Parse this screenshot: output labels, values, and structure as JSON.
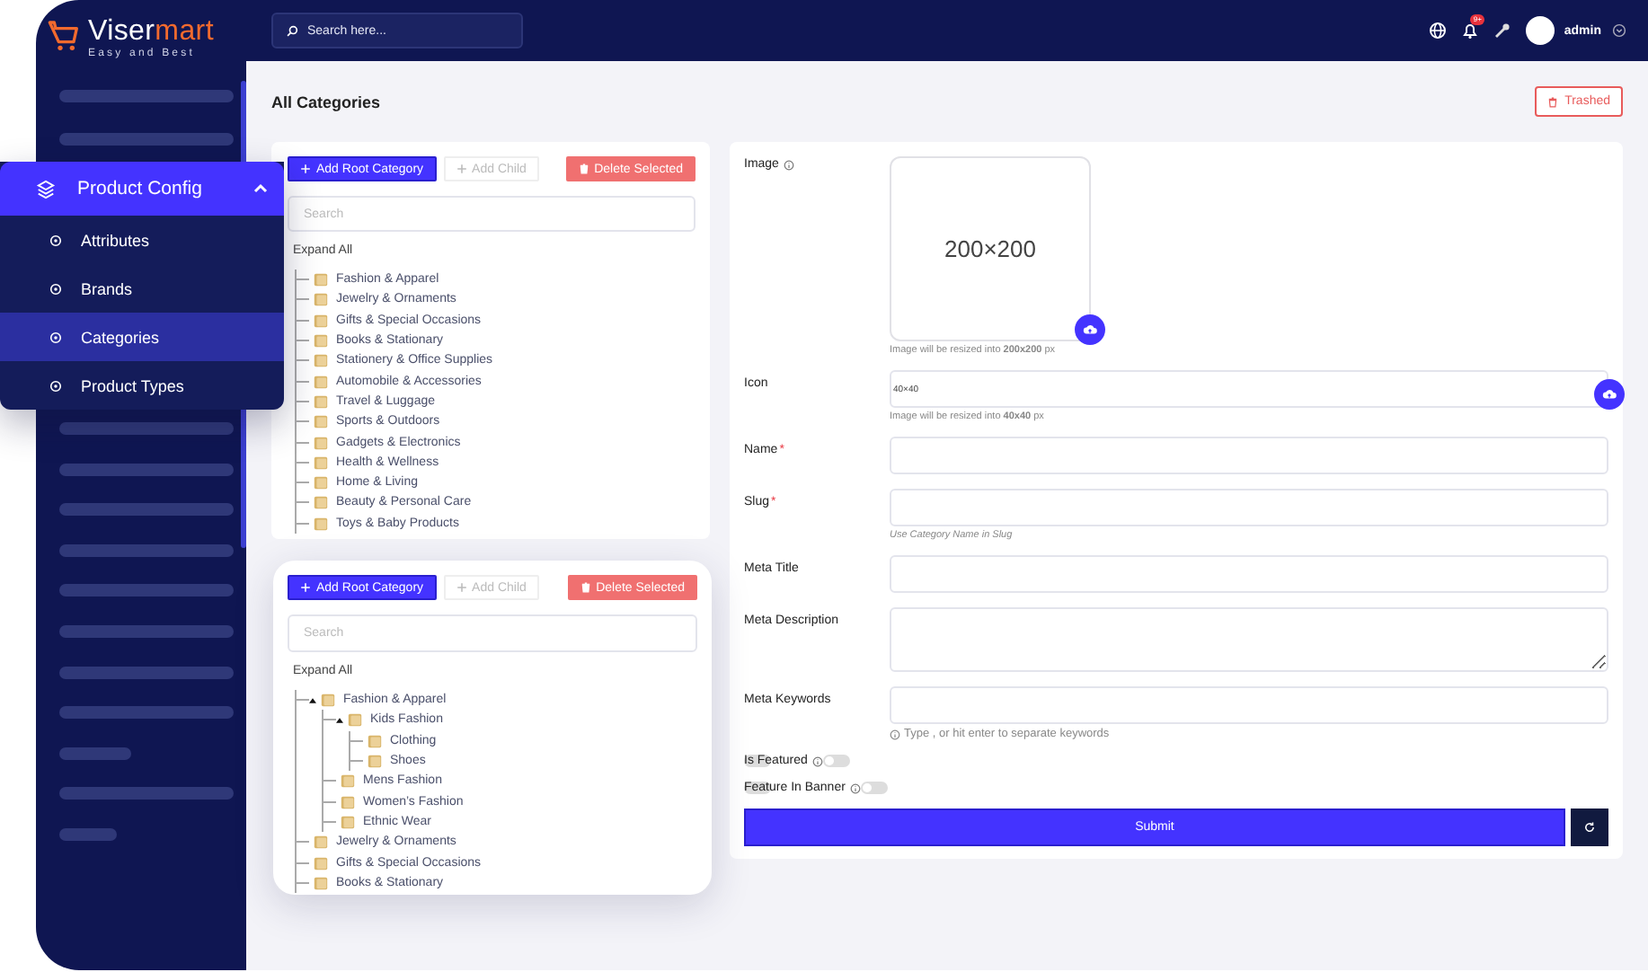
{
  "brand": {
    "name_start": "Viser",
    "name_end": "mart",
    "tagline": "Easy and Best"
  },
  "header": {
    "search_placeholder": "Search here...",
    "notification_count": "9+",
    "user_name": "admin"
  },
  "sidebar_menu": {
    "title": "Product Config",
    "expanded": true,
    "items": [
      {
        "label": "Attributes",
        "selected": false
      },
      {
        "label": "Brands",
        "selected": false
      },
      {
        "label": "Categories",
        "selected": true
      },
      {
        "label": "Product Types",
        "selected": false
      }
    ]
  },
  "page_title": "All Categories",
  "trashed_button": "Trashed",
  "category_trees": [
    {
      "buttons": [
        {
          "kind": "add-root",
          "label": "Add Root Category",
          "disabled": false
        },
        {
          "kind": "add-child",
          "label": "Add Child",
          "disabled": true
        },
        {
          "kind": "delete",
          "label": "Delete Selected",
          "disabled": false
        }
      ],
      "search_placeholder": "Search",
      "expand_all": "Expand All",
      "nodes": [
        {
          "label": "Fashion & Apparel"
        },
        {
          "label": "Jewelry & Ornaments"
        },
        {
          "label": "Gifts & Special Occasions"
        },
        {
          "label": "Books & Stationary"
        },
        {
          "label": "Stationery & Office Supplies"
        },
        {
          "label": "Automobile & Accessories"
        },
        {
          "label": "Travel & Luggage"
        },
        {
          "label": "Sports & Outdoors"
        },
        {
          "label": "Gadgets & Electronics"
        },
        {
          "label": "Health & Wellness"
        },
        {
          "label": "Home & Living"
        },
        {
          "label": "Beauty & Personal Care"
        },
        {
          "label": "Toys & Baby Products"
        }
      ]
    },
    {
      "buttons": [
        {
          "kind": "add-root",
          "label": "Add Root Category",
          "disabled": false
        },
        {
          "kind": "add-child",
          "label": "Add Child",
          "disabled": true
        },
        {
          "kind": "delete",
          "label": "Delete Selected",
          "disabled": false
        }
      ],
      "search_placeholder": "Search",
      "expand_all": "Expand All",
      "nodes": [
        {
          "label": "Fashion & Apparel",
          "children": [
            {
              "label": "Kids Fashion",
              "children": [
                {
                  "label": "Clothing"
                },
                {
                  "label": "Shoes"
                }
              ]
            },
            {
              "label": "Mens Fashion"
            },
            {
              "label": "Women’s Fashion"
            },
            {
              "label": "Ethnic Wear"
            }
          ]
        },
        {
          "label": "Jewelry & Ornaments"
        },
        {
          "label": "Gifts & Special Occasions"
        },
        {
          "label": "Books & Stationary"
        }
      ]
    }
  ],
  "form": {
    "fields": [
      {
        "kind": "image",
        "label": "Image",
        "info": true,
        "preview": "200×200",
        "hint": "Image will be resized into **200x200** px"
      },
      {
        "kind": "file",
        "label": "Icon",
        "value": "40×40",
        "hint": "Image will be resized into **40x40** px"
      },
      {
        "kind": "text",
        "label": "Name",
        "required_mark": "*"
      },
      {
        "kind": "text",
        "label": "Slug",
        "required_mark": "*",
        "hint": "Use Category Name in Slug"
      },
      {
        "kind": "text",
        "label": "Meta Title"
      },
      {
        "kind": "textarea",
        "label": "Meta Description"
      },
      {
        "kind": "tags",
        "label": "Meta Keywords",
        "hint": "Type , or hit enter to separate keywords"
      },
      {
        "kind": "toggle",
        "label": "Is Featured",
        "info": true,
        "on": false
      },
      {
        "kind": "toggle",
        "label": "Feature In Banner",
        "info": true,
        "on": false
      }
    ],
    "submit": "Submit"
  }
}
